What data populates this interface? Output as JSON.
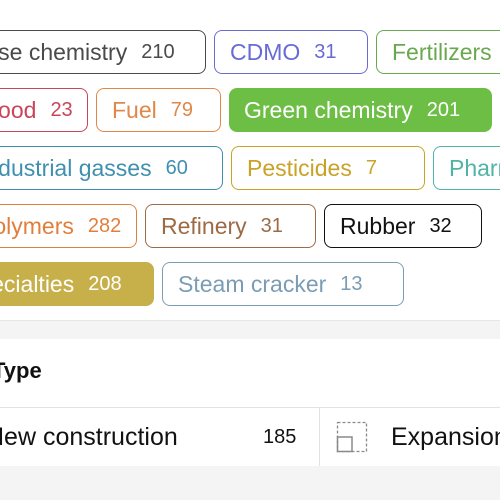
{
  "tags": [
    {
      "label": "Base chemistry",
      "count": "210",
      "color": "#4a4a4a",
      "style": "outline"
    },
    {
      "label": "CDMO",
      "count": "31",
      "color": "#6a6ad6",
      "style": "outline"
    },
    {
      "label": "Fertilizers",
      "count": "",
      "color": "#6aa84f",
      "style": "outline"
    },
    {
      "label": "Food",
      "count": "23",
      "color": "#c9455a",
      "style": "outline"
    },
    {
      "label": "Fuel",
      "count": "79",
      "color": "#e0884a",
      "style": "outline"
    },
    {
      "label": "Green chemistry",
      "count": "201",
      "color": "#6cbe45",
      "style": "filled"
    },
    {
      "label": "Industrial gasses",
      "count": "60",
      "color": "#3f8fb0",
      "style": "outline"
    },
    {
      "label": "Pesticides",
      "count": "7",
      "color": "#c9a227",
      "style": "outline"
    },
    {
      "label": "Pharma",
      "count": "",
      "color": "#4fb3a6",
      "style": "outline"
    },
    {
      "label": "Polymers",
      "count": "282",
      "color": "#e07f3c",
      "style": "outline"
    },
    {
      "label": "Refinery",
      "count": "31",
      "color": "#9c6b45",
      "style": "outline"
    },
    {
      "label": "Rubber",
      "count": "32",
      "color": "#111111",
      "style": "outline"
    },
    {
      "label": "Specialties",
      "count": "208",
      "color": "#c7b04a",
      "style": "filled"
    },
    {
      "label": "Steam cracker",
      "count": "13",
      "color": "#7b9db4",
      "style": "outline"
    }
  ],
  "section": {
    "title": "Type"
  },
  "types": [
    {
      "label": "New construction",
      "count": "185"
    },
    {
      "label": "Expansion",
      "count": ""
    }
  ]
}
